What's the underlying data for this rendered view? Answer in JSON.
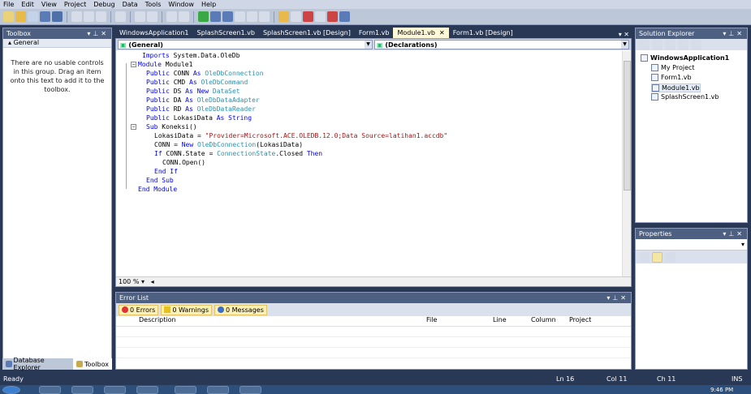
{
  "menu": [
    "File",
    "Edit",
    "View",
    "Project",
    "Debug",
    "Data",
    "Tools",
    "Window",
    "Help"
  ],
  "toolbox": {
    "title": "Toolbox",
    "group": "General",
    "empty_message": "There are no usable controls in this group. Drag an item onto this text to add it to the toolbox.",
    "bottom_tabs": [
      "Database Explorer",
      "Toolbox"
    ]
  },
  "doc_tabs": [
    "WindowsApplication1",
    "SplashScreen1.vb",
    "SplashScreen1.vb [Design]",
    "Form1.vb",
    "Module1.vb",
    "Form1.vb [Design]"
  ],
  "editor": {
    "left_combo": "(General)",
    "right_combo": "(Declarations)",
    "zoom": "100 %",
    "lines": [
      {
        "indent": 1,
        "tokens": [
          [
            "kw",
            "Imports"
          ],
          [
            "t",
            " System.Data.OleDb"
          ]
        ]
      },
      {
        "indent": 0,
        "tokens": [
          [
            "kw",
            "Module"
          ],
          [
            "t",
            " Module1"
          ]
        ]
      },
      {
        "indent": 2,
        "tokens": [
          [
            "kw",
            "Public"
          ],
          [
            "t",
            " CONN "
          ],
          [
            "kw",
            "As"
          ],
          [
            "t",
            " "
          ],
          [
            "ty",
            "OleDbConnection"
          ]
        ]
      },
      {
        "indent": 2,
        "tokens": [
          [
            "kw",
            "Public"
          ],
          [
            "t",
            " CMD "
          ],
          [
            "kw",
            "As"
          ],
          [
            "t",
            " "
          ],
          [
            "ty",
            "OleDbCommand"
          ]
        ]
      },
      {
        "indent": 2,
        "tokens": [
          [
            "kw",
            "Public"
          ],
          [
            "t",
            " DS "
          ],
          [
            "kw",
            "As New"
          ],
          [
            "t",
            " "
          ],
          [
            "ty",
            "DataSet"
          ]
        ]
      },
      {
        "indent": 2,
        "tokens": [
          [
            "kw",
            "Public"
          ],
          [
            "t",
            " DA "
          ],
          [
            "kw",
            "As"
          ],
          [
            "t",
            " "
          ],
          [
            "ty",
            "OleDbDataAdapter"
          ]
        ]
      },
      {
        "indent": 2,
        "tokens": [
          [
            "kw",
            "Public"
          ],
          [
            "t",
            " RD "
          ],
          [
            "kw",
            "As"
          ],
          [
            "t",
            " "
          ],
          [
            "ty",
            "OleDbDataReader"
          ]
        ]
      },
      {
        "indent": 2,
        "tokens": [
          [
            "kw",
            "Public"
          ],
          [
            "t",
            " LokasiData "
          ],
          [
            "kw",
            "As String"
          ]
        ]
      },
      {
        "indent": 2,
        "tokens": [
          [
            "kw",
            "Sub"
          ],
          [
            "t",
            " Koneksi()"
          ]
        ]
      },
      {
        "indent": 4,
        "tokens": [
          [
            "t",
            "LokasiData = "
          ],
          [
            "str",
            "\"Provider=Microsoft.ACE.OLEDB.12.0;Data Source=latihan1.accdb\""
          ]
        ]
      },
      {
        "indent": 4,
        "tokens": [
          [
            "t",
            "CONN = "
          ],
          [
            "kw",
            "New"
          ],
          [
            "t",
            " "
          ],
          [
            "ty",
            "OleDbConnection"
          ],
          [
            "t",
            "(LokasiData)"
          ]
        ]
      },
      {
        "indent": 4,
        "tokens": [
          [
            "kw",
            "If"
          ],
          [
            "t",
            " CONN.State = "
          ],
          [
            "ty",
            "ConnectionState"
          ],
          [
            "t",
            ".Closed "
          ],
          [
            "kw",
            "Then"
          ]
        ]
      },
      {
        "indent": 6,
        "tokens": [
          [
            "t",
            "CONN.Open()"
          ]
        ]
      },
      {
        "indent": 4,
        "tokens": [
          [
            "kw",
            "End If"
          ]
        ]
      },
      {
        "indent": 2,
        "tokens": [
          [
            "kw",
            "End Sub"
          ]
        ]
      },
      {
        "indent": 0,
        "tokens": [
          [
            "kw",
            "End Module"
          ]
        ]
      }
    ]
  },
  "error_list": {
    "title": "Error List",
    "errors": "0 Errors",
    "warnings": "0 Warnings",
    "messages": "0 Messages",
    "columns": [
      "Description",
      "File",
      "Line",
      "Column",
      "Project"
    ]
  },
  "solution_explorer": {
    "title": "Solution Explorer",
    "project": "WindowsApplication1",
    "items": [
      "My Project",
      "Form1.vb",
      "Module1.vb",
      "SplashScreen1.vb"
    ]
  },
  "properties": {
    "title": "Properties"
  },
  "status": {
    "ready": "Ready",
    "ln": "Ln 16",
    "col": "Col 11",
    "ch": "Ch 11",
    "mode": "INS"
  },
  "clock": "9:46 PM",
  "colors": {
    "keyword": "#0000ff",
    "type": "#2b91af",
    "string": "#a31515",
    "chrome": "#293955"
  }
}
